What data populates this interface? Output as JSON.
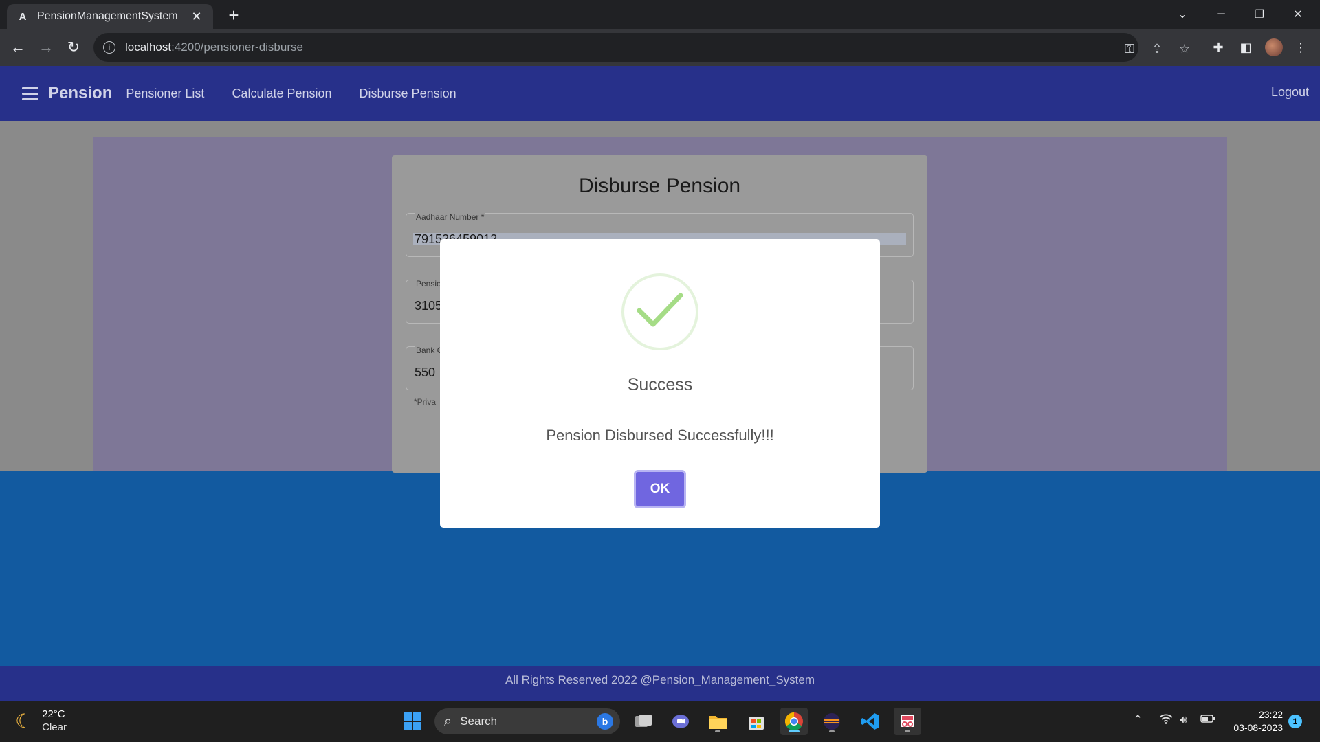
{
  "browser": {
    "tab_title": "PensionManagementSystem",
    "tab_favicon": "A",
    "url_host": "localhost",
    "url_path": ":4200/pensioner-disburse"
  },
  "app": {
    "brand": "Pension",
    "nav": [
      "Pensioner List",
      "Calculate Pension",
      "Disburse Pension"
    ],
    "logout": "Logout",
    "footer": "All Rights Reserved 2022 @Pension_Management_System"
  },
  "form": {
    "title": "Disburse Pension",
    "fields": [
      {
        "label": "Aadhaar Number *",
        "value": "791526459012"
      },
      {
        "label": "Pensio",
        "value": "3105"
      },
      {
        "label": "Bank C",
        "value": "550"
      }
    ],
    "hint": "*Priva"
  },
  "modal": {
    "title": "Success",
    "message": "Pension Disbursed Successfully!!!",
    "ok_label": "OK"
  },
  "taskbar": {
    "temperature": "22°C",
    "condition": "Clear",
    "search_label": "Search",
    "time": "23:22",
    "date": "03-08-2023",
    "notification_count": "1"
  },
  "colors": {
    "appbar": "#27308a",
    "ok_button": "#7066e0",
    "success_check": "#a5dc86"
  }
}
